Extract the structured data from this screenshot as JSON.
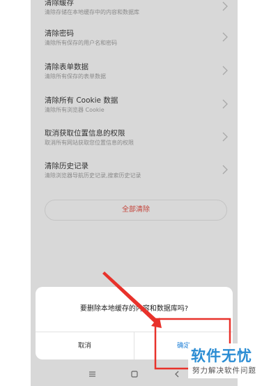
{
  "settings_list": {
    "items": [
      {
        "title": "清除缓存",
        "desc": "清除存储在本地缓存中的内容和数据库"
      },
      {
        "title": "清除密码",
        "desc": "清除所有保存的用户名和密码"
      },
      {
        "title": "清除表单数据",
        "desc": "清除所有保存的表单数据"
      },
      {
        "title": "清除所有 Cookie 数据",
        "desc": "清除所有浏览器 Cookie"
      },
      {
        "title": "取消获取位置信息的权限",
        "desc": "取消所有网站获取您位置信息的权限"
      },
      {
        "title": "清除历史记录",
        "desc": "清除浏览器导航历史记录,搜索历史记录"
      }
    ],
    "clear_all_label": "全部清除"
  },
  "dialog": {
    "message": "要删除本地缓存的内容和数据库吗?",
    "cancel_label": "取消",
    "ok_label": "确定"
  },
  "nav_bar": {
    "menu_icon": "menu-icon",
    "home_icon": "home-icon",
    "back_icon": "back-icon"
  },
  "annotation": {
    "arrow_color": "#e8322b",
    "highlight_color": "#e8322b"
  },
  "watermark": {
    "title": "软件无忧",
    "subtitle": "努力解决软件问题"
  }
}
